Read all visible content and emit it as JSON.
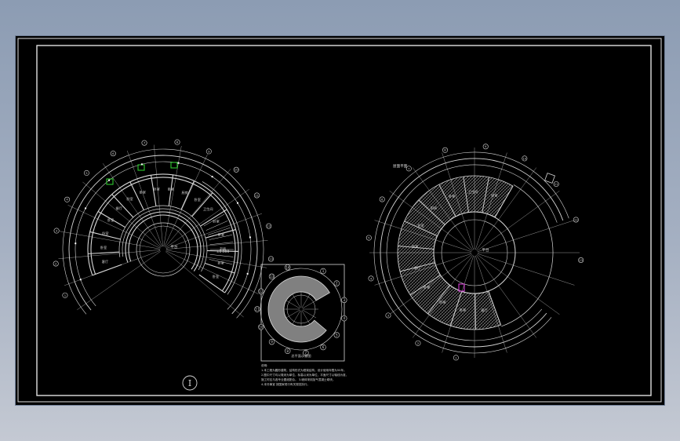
{
  "drawing": {
    "plan_left": {
      "center_label": "平台",
      "room_labels": [
        "客厅",
        "卧室",
        "卧室",
        "卧室",
        "餐厅",
        "卧室",
        "卧室",
        "卧室",
        "卧室",
        "厨房",
        "卧室",
        "卫生间",
        "卧室",
        "卧室",
        "书房",
        "卧室",
        "卧室"
      ],
      "grid_bubbles": [
        "1",
        "2",
        "3",
        "4",
        "5",
        "6",
        "7",
        "8",
        "9",
        "10",
        "11",
        "12",
        "13"
      ],
      "elevation_tag": "±0.000"
    },
    "plan_right": {
      "center_label": "平台",
      "room_labels": [
        "客厅",
        "卧室",
        "卧室",
        "卧室",
        "餐厅",
        "卧室",
        "卧室",
        "厨房",
        "卧室",
        "卫生间",
        "卧室"
      ],
      "tag_label": "屋面平面",
      "grid_bubbles": [
        "1",
        "2",
        "3",
        "4",
        "5",
        "6",
        "7",
        "8",
        "9",
        "10",
        "11",
        "12",
        "13"
      ]
    },
    "key_plan": {
      "title": "总平面示意图",
      "bubbles": [
        "1",
        "2",
        "3",
        "4",
        "5",
        "6",
        "7",
        "8",
        "9",
        "10",
        "11",
        "12",
        "13",
        "14"
      ]
    },
    "notes": {
      "heading": "说明:",
      "lines": [
        "1.本工程为圆形建筑，结构形式为框架结构，设计使用年限为50年。",
        "2.图中尺寸均以毫米为单位，标高以米为单位，平面尺寸以轴线为准，",
        "施工时应与各专业图纸配合。  3.墙体采用加气混凝土砌块。",
        "4.未尽事宜 按国家现行有关规范执行。"
      ]
    },
    "north_symbol": "Ⅰ",
    "colors": {
      "line": "#d8d8d8",
      "hatch": "#8a8a8a",
      "key_fill": "#808080",
      "green_marker": "#2ec82e",
      "magenta_marker": "#d23cd2"
    }
  }
}
